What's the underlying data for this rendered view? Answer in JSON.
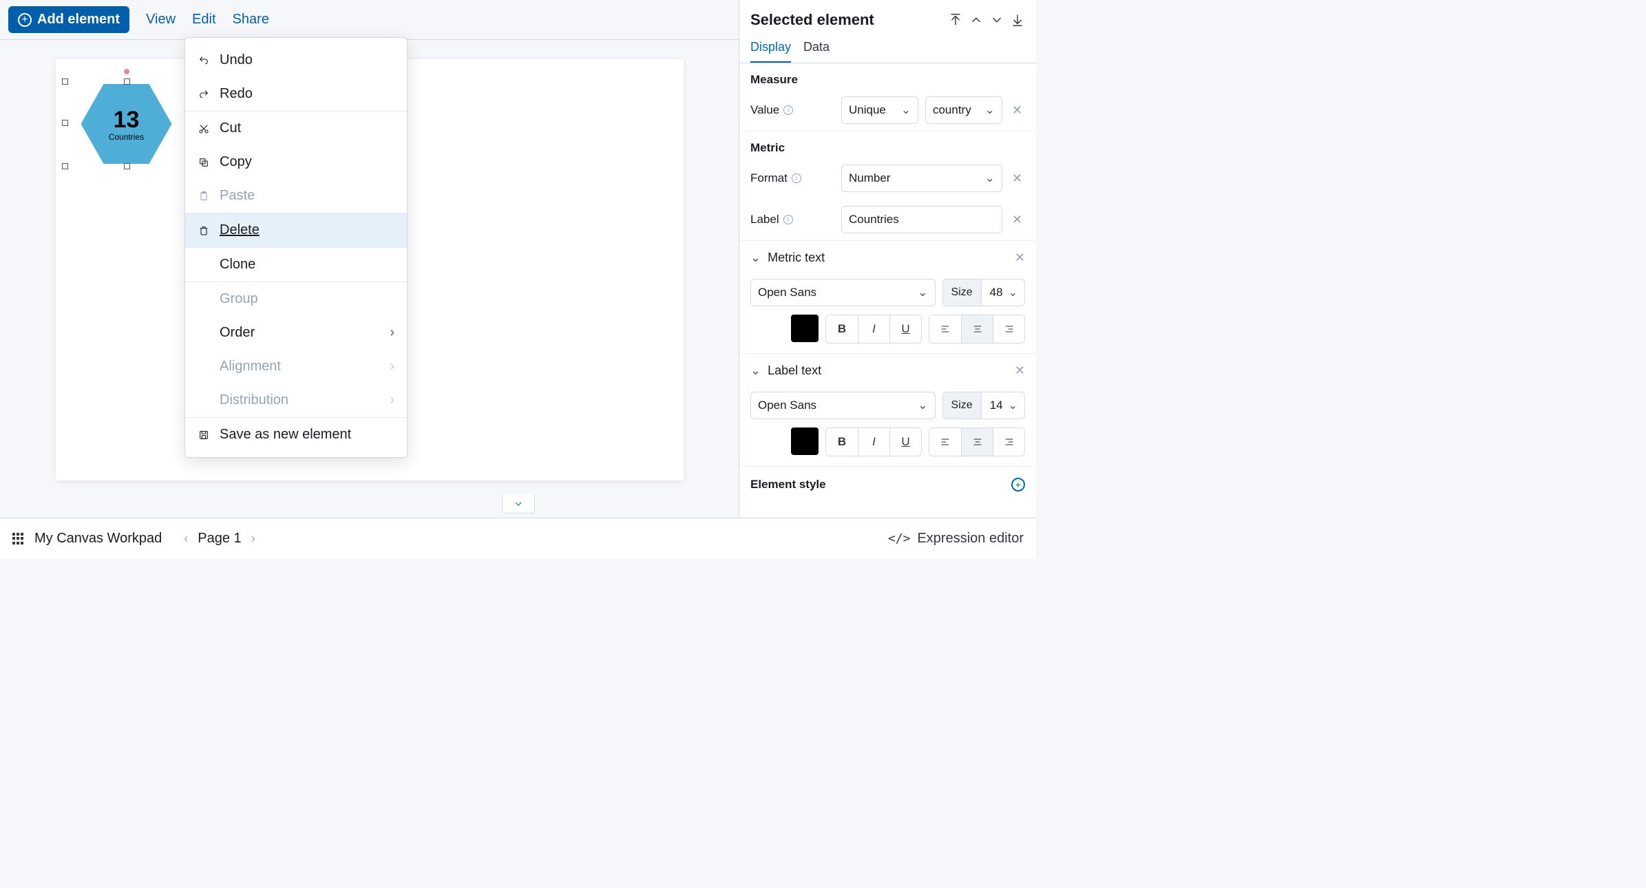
{
  "topbar": {
    "add_element": "Add element",
    "view": "View",
    "edit": "Edit",
    "share": "Share"
  },
  "canvas_element": {
    "value": "13",
    "label": "Countries"
  },
  "context_menu": {
    "undo": "Undo",
    "redo": "Redo",
    "cut": "Cut",
    "copy": "Copy",
    "paste": "Paste",
    "delete": "Delete",
    "clone": "Clone",
    "group": "Group",
    "order": "Order",
    "alignment": "Alignment",
    "distribution": "Distribution",
    "save_as_new": "Save as new element"
  },
  "panel": {
    "title": "Selected element",
    "tabs": {
      "display": "Display",
      "data": "Data"
    },
    "measure": {
      "heading": "Measure",
      "value_label": "Value",
      "aggregation": "Unique",
      "field": "country"
    },
    "metric": {
      "heading": "Metric",
      "format_label": "Format",
      "format_value": "Number",
      "label_label": "Label",
      "label_value": "Countries"
    },
    "metric_text": {
      "heading": "Metric text",
      "font": "Open Sans",
      "size_label": "Size",
      "size_value": "48"
    },
    "label_text": {
      "heading": "Label text",
      "font": "Open Sans",
      "size_label": "Size",
      "size_value": "14"
    },
    "element_style": "Element style"
  },
  "footer": {
    "workpad_name": "My Canvas Workpad",
    "page_label": "Page 1",
    "expression_editor": "Expression editor"
  }
}
